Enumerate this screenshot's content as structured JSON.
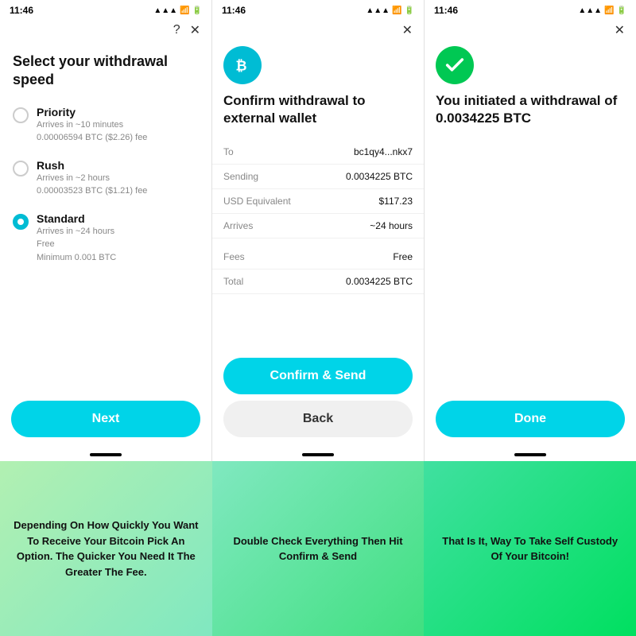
{
  "screens": [
    {
      "id": "screen1",
      "status_time": "11:46",
      "title": "Select your withdrawal speed",
      "options": [
        {
          "name": "Priority",
          "detail1": "Arrives in ~10 minutes",
          "detail2": "0.00006594 BTC ($2.26) fee",
          "selected": false
        },
        {
          "name": "Rush",
          "detail1": "Arrives in ~2 hours",
          "detail2": "0.00003523 BTC ($1.21) fee",
          "selected": false
        },
        {
          "name": "Standard",
          "detail1": "Arrives in ~24 hours",
          "detail2": "Free",
          "detail3": "Minimum 0.001 BTC",
          "selected": true
        }
      ],
      "next_label": "Next",
      "has_help": true,
      "has_close": true
    },
    {
      "id": "screen2",
      "status_time": "11:46",
      "title": "Confirm withdrawal to external wallet",
      "details": [
        {
          "label": "To",
          "value": "bc1qy4...nkx7"
        },
        {
          "label": "Sending",
          "value": "0.0034225 BTC"
        },
        {
          "label": "USD Equivalent",
          "value": "$117.23"
        },
        {
          "label": "Arrives",
          "value": "~24 hours"
        }
      ],
      "fees_details": [
        {
          "label": "Fees",
          "value": "Free"
        },
        {
          "label": "Total",
          "value": "0.0034225 BTC"
        }
      ],
      "confirm_label": "Confirm & Send",
      "back_label": "Back",
      "has_close": true,
      "icon": "bitcoin"
    },
    {
      "id": "screen3",
      "status_time": "11:46",
      "title": "You initiated a withdrawal of 0.0034225 BTC",
      "done_label": "Done",
      "has_close": true,
      "icon": "check"
    }
  ],
  "annotations": [
    {
      "text": "Depending On How Quickly You Want To Receive Your Bitcoin Pick An Option. The Quicker You Need It The Greater The Fee."
    },
    {
      "text": "Double Check Everything Then Hit Confirm & Send"
    },
    {
      "text": "That Is It, Way To Take Self Custody Of Your Bitcoin!"
    }
  ]
}
